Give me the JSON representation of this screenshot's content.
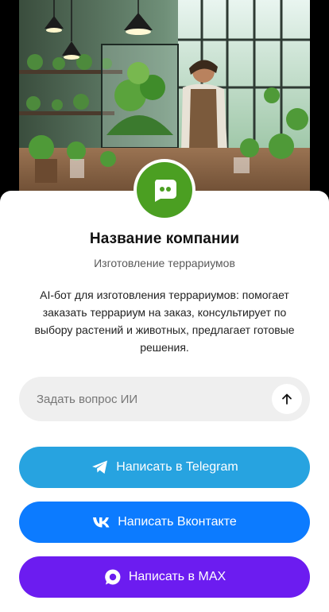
{
  "company": {
    "name": "Название компании",
    "subtitle": "Изготовление террариумов",
    "description": "AI-бот для изготовления террариумов: помогает заказать террариум на заказ, консультирует по выбору растений и животных, предлагает готовые решения."
  },
  "hero": {
    "image_icon": "terrarium-workshop-photo"
  },
  "avatar": {
    "icon": "chat-bot-icon",
    "color": "#4b9f22"
  },
  "ask": {
    "placeholder": "Задать вопрос ИИ",
    "send_icon": "arrow-up-icon"
  },
  "buttons": {
    "telegram": {
      "label": "Написать в Telegram",
      "icon": "telegram-icon",
      "color": "#27a3e0"
    },
    "vk": {
      "label": "Написать Вконтакте",
      "icon": "vk-icon",
      "color": "#0c7bff"
    },
    "max": {
      "label": "Написать в MAX",
      "icon": "max-icon",
      "color": "#6c1cf0"
    }
  }
}
